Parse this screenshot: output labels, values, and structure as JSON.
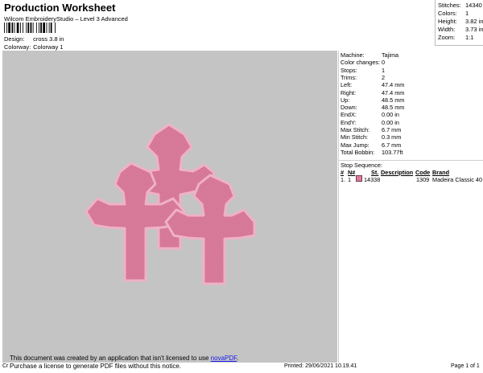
{
  "header": {
    "title": "Production Worksheet",
    "subtitle": "Wilcom EmbroideryStudio – Level 3 Advanced",
    "design_label": "Design:",
    "design_value": "cross 3.8 in",
    "colorway_label": "Colorway:",
    "colorway_value": "Colorway 1"
  },
  "summary": {
    "stitches_label": "Stitches:",
    "stitches": "14340",
    "colors_label": "Colors:",
    "colors": "1",
    "height_label": "Height:",
    "height": "3.82 in",
    "width_label": "Width:",
    "width": "3.73 in",
    "zoom_label": "Zoom:",
    "zoom": "1:1"
  },
  "stats": [
    {
      "label": "Machine:",
      "value": "Tajima"
    },
    {
      "label": "Color changes:",
      "value": "0"
    },
    {
      "label": "Stops:",
      "value": "1"
    },
    {
      "label": "Trims:",
      "value": "2"
    },
    {
      "label": "Left:",
      "value": "47.4 mm"
    },
    {
      "label": "Right:",
      "value": "47.4 mm"
    },
    {
      "label": "Up:",
      "value": "48.5 mm"
    },
    {
      "label": "Down:",
      "value": "48.5 mm"
    },
    {
      "label": "EndX:",
      "value": "0.00 in"
    },
    {
      "label": "EndY:",
      "value": "0.00 in"
    },
    {
      "label": "Max Stitch:",
      "value": "6.7 mm"
    },
    {
      "label": "Min Stitch:",
      "value": "0.3 mm"
    },
    {
      "label": "Max Jump:",
      "value": "6.7 mm"
    },
    {
      "label": "Total Bobbin:",
      "value": "103.77ft"
    }
  ],
  "stop_sequence": {
    "title": "Stop Sequence:",
    "headers": [
      "#",
      "N#",
      "St.",
      "Description",
      "Code",
      "Brand"
    ],
    "rows": [
      {
        "num": "1.",
        "needle": "1",
        "stitches": "14338",
        "description": "",
        "code": "1309",
        "brand": "Madeira Classic 40",
        "color": "#d97b9b"
      }
    ]
  },
  "design_colors": {
    "background": "#c4c4c4",
    "thread": "#d97b9b",
    "outline": "#efb1c6",
    "stitch_shadow": "#9c4a69"
  },
  "notice": {
    "line1_prefix": "This document was created by an application that isn't licensed to use ",
    "link": "novaPDF",
    "line1_suffix": ".",
    "line2": "Purchase a license to generate PDF files without this notice."
  },
  "footer": {
    "left": "Cr",
    "printed": "Printed: 29/06/2021 10.19.41",
    "page": "Page 1 of 1"
  }
}
